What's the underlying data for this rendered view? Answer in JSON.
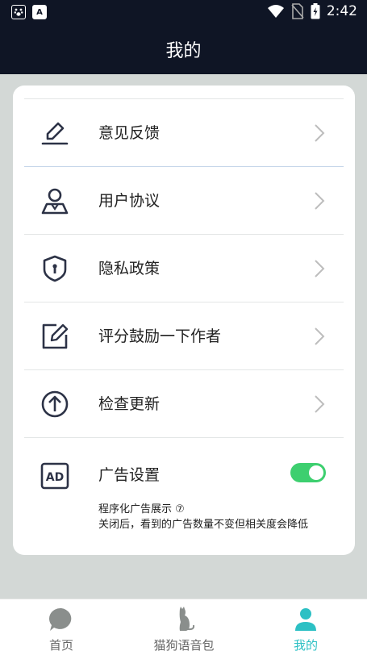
{
  "status_bar": {
    "time": "2:42",
    "app_icon_letter": "A"
  },
  "header": {
    "title": "我的"
  },
  "menu": {
    "items": [
      {
        "label": "意见反馈",
        "icon": "edit-pen-icon"
      },
      {
        "label": "用户协议",
        "icon": "user-icon"
      },
      {
        "label": "隐私政策",
        "icon": "shield-icon"
      },
      {
        "label": "评分鼓励一下作者",
        "icon": "edit-square-icon"
      },
      {
        "label": "检查更新",
        "icon": "arrow-up-circle-icon"
      }
    ]
  },
  "ad_settings": {
    "icon_text": "AD",
    "title": "广告设置",
    "toggle_on": true,
    "subtitle": "程序化广告展示 ⑦",
    "description": "关闭后，看到的广告数量不变但相关度会降低"
  },
  "tabbar": {
    "tabs": [
      {
        "label": "首页",
        "active": false
      },
      {
        "label": "猫狗语音包",
        "active": false
      },
      {
        "label": "我的",
        "active": true
      }
    ]
  },
  "colors": {
    "header_bg": "#0f1525",
    "accent": "#2cc0c4",
    "toggle_on": "#3dcf6f",
    "page_bg": "#d3d8d6"
  }
}
